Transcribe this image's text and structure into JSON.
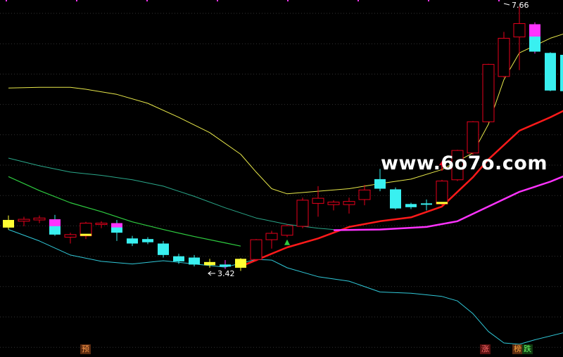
{
  "watermark": "www.6o7o.com",
  "annotations": {
    "high_label": "7.66",
    "low_label": "3.42"
  },
  "badges": {
    "b1": "预",
    "b2": "涨",
    "b3": "榜",
    "b4": "跌"
  },
  "colors": {
    "up": "#e8001c",
    "down": "#39f0f0",
    "yellow": "#ffff33",
    "magenta": "#ff33ff",
    "ma_red": "#ff1a1a",
    "band_upper": "#e8e84a",
    "band_lower": "#30c8d8",
    "green": "#2ecc40",
    "teal": "#2aa88a",
    "grid": "#333333"
  },
  "chart_data": {
    "type": "candlestick",
    "y_range": [
      2.2,
      7.8
    ],
    "candles": [
      {
        "o": 4.35,
        "h": 4.42,
        "l": 4.2,
        "c": 4.23,
        "color": "yellow"
      },
      {
        "o": 4.33,
        "h": 4.4,
        "l": 4.25,
        "c": 4.36,
        "color": "up"
      },
      {
        "o": 4.35,
        "h": 4.42,
        "l": 4.3,
        "c": 4.38,
        "color": "up"
      },
      {
        "o": 4.36,
        "h": 4.43,
        "l": 4.1,
        "c": 4.12,
        "color": "down",
        "top": "magenta"
      },
      {
        "o": 4.08,
        "h": 4.15,
        "l": 3.98,
        "c": 4.12,
        "color": "up"
      },
      {
        "o": 4.1,
        "h": 4.32,
        "l": 4.05,
        "c": 4.3,
        "color": "up",
        "bottom": "yellow"
      },
      {
        "o": 4.3,
        "h": 4.33,
        "l": 4.22,
        "c": 4.3,
        "color": "up"
      },
      {
        "o": 4.3,
        "h": 4.35,
        "l": 4.02,
        "c": 4.15,
        "color": "down",
        "top": "magenta"
      },
      {
        "o": 4.06,
        "h": 4.1,
        "l": 3.94,
        "c": 3.98,
        "color": "down"
      },
      {
        "o": 4.05,
        "h": 4.08,
        "l": 3.97,
        "c": 4.0,
        "color": "down"
      },
      {
        "o": 3.98,
        "h": 4.02,
        "l": 3.76,
        "c": 3.8,
        "color": "down"
      },
      {
        "o": 3.78,
        "h": 3.82,
        "l": 3.66,
        "c": 3.7,
        "color": "down"
      },
      {
        "o": 3.76,
        "h": 3.8,
        "l": 3.62,
        "c": 3.65,
        "color": "down"
      },
      {
        "o": 3.69,
        "h": 3.74,
        "l": 3.6,
        "c": 3.64,
        "color": "yellow"
      },
      {
        "o": 3.64,
        "h": 3.72,
        "l": 3.58,
        "c": 3.62,
        "color": "magenta",
        "bottom": "down"
      },
      {
        "o": 3.6,
        "h": 3.75,
        "l": 3.55,
        "c": 3.74,
        "color": "yellow"
      },
      {
        "o": 3.73,
        "h": 4.05,
        "l": 3.7,
        "c": 4.04,
        "color": "up"
      },
      {
        "o": 4.04,
        "h": 4.18,
        "l": 3.9,
        "c": 4.14,
        "color": "up"
      },
      {
        "o": 4.11,
        "h": 4.28,
        "l": 4.08,
        "c": 4.26,
        "color": "up"
      },
      {
        "o": 4.25,
        "h": 4.7,
        "l": 4.22,
        "c": 4.66,
        "color": "up"
      },
      {
        "o": 4.61,
        "h": 4.88,
        "l": 4.4,
        "c": 4.69,
        "color": "up"
      },
      {
        "o": 4.59,
        "h": 4.66,
        "l": 4.5,
        "c": 4.63,
        "color": "up"
      },
      {
        "o": 4.59,
        "h": 4.7,
        "l": 4.45,
        "c": 4.64,
        "color": "up"
      },
      {
        "o": 4.67,
        "h": 4.9,
        "l": 4.58,
        "c": 4.82,
        "color": "up"
      },
      {
        "o": 4.99,
        "h": 5.15,
        "l": 4.8,
        "c": 4.84,
        "color": "down"
      },
      {
        "o": 4.83,
        "h": 4.86,
        "l": 4.51,
        "c": 4.53,
        "color": "down"
      },
      {
        "o": 4.6,
        "h": 4.62,
        "l": 4.52,
        "c": 4.55,
        "color": "down"
      },
      {
        "o": 4.61,
        "h": 4.67,
        "l": 4.5,
        "c": 4.6,
        "color": "down"
      },
      {
        "o": 4.6,
        "h": 4.98,
        "l": 4.58,
        "c": 4.96,
        "color": "up",
        "bottom": "yellow"
      },
      {
        "o": 4.98,
        "h": 5.45,
        "l": 4.96,
        "c": 5.44,
        "color": "up"
      },
      {
        "o": 5.4,
        "h": 5.9,
        "l": 5.37,
        "c": 5.89,
        "color": "up"
      },
      {
        "o": 5.89,
        "h": 6.8,
        "l": 5.88,
        "c": 6.79,
        "color": "up"
      },
      {
        "o": 6.6,
        "h": 7.3,
        "l": 6.58,
        "c": 7.2,
        "color": "up"
      },
      {
        "o": 7.22,
        "h": 7.7,
        "l": 6.7,
        "c": 7.43,
        "color": "up"
      },
      {
        "o": 7.42,
        "h": 7.45,
        "l": 6.96,
        "c": 6.99,
        "color": "magenta",
        "bottom": "down"
      },
      {
        "o": 6.97,
        "h": 6.98,
        "l": 6.37,
        "c": 6.38,
        "color": "down"
      },
      {
        "o": 6.94,
        "h": 6.95,
        "l": 6.37,
        "c": 6.37,
        "color": "down"
      }
    ],
    "lines": {
      "band_upper": [
        [
          0,
          6.42
        ],
        [
          2,
          6.43
        ],
        [
          4,
          6.43
        ],
        [
          5,
          6.4
        ],
        [
          7,
          6.32
        ],
        [
          9,
          6.18
        ],
        [
          11,
          5.96
        ],
        [
          13,
          5.72
        ],
        [
          15,
          5.38
        ],
        [
          16,
          5.1
        ],
        [
          17,
          4.84
        ],
        [
          18,
          4.76
        ],
        [
          20,
          4.8
        ],
        [
          22,
          4.84
        ],
        [
          24,
          4.92
        ],
        [
          26,
          4.99
        ],
        [
          28,
          5.14
        ],
        [
          30,
          5.4
        ],
        [
          31,
          5.85
        ],
        [
          32,
          6.55
        ],
        [
          33,
          6.97
        ],
        [
          35,
          7.2
        ],
        [
          36,
          7.28
        ]
      ],
      "band_lower": [
        [
          0,
          4.2
        ],
        [
          2,
          4.02
        ],
        [
          4,
          3.8
        ],
        [
          6,
          3.7
        ],
        [
          8,
          3.66
        ],
        [
          10,
          3.71
        ],
        [
          12,
          3.66
        ],
        [
          14,
          3.61
        ],
        [
          15,
          3.67
        ],
        [
          16,
          3.73
        ],
        [
          17,
          3.72
        ],
        [
          18,
          3.6
        ],
        [
          20,
          3.46
        ],
        [
          22,
          3.39
        ],
        [
          24,
          3.22
        ],
        [
          26,
          3.2
        ],
        [
          28,
          3.15
        ],
        [
          29,
          3.08
        ],
        [
          30,
          2.88
        ],
        [
          31,
          2.6
        ],
        [
          32,
          2.42
        ],
        [
          33,
          2.4
        ],
        [
          34,
          2.47
        ],
        [
          36,
          2.59
        ]
      ],
      "ma_red": [
        [
          15,
          3.62
        ],
        [
          18,
          3.92
        ],
        [
          20,
          4.06
        ],
        [
          22,
          4.24
        ],
        [
          24,
          4.33
        ],
        [
          26,
          4.39
        ],
        [
          28,
          4.56
        ],
        [
          30,
          5.02
        ],
        [
          31,
          5.3
        ],
        [
          33,
          5.75
        ],
        [
          35,
          5.96
        ],
        [
          36,
          6.08
        ]
      ],
      "ma_magenta": [
        [
          21,
          4.19
        ],
        [
          24,
          4.2
        ],
        [
          27,
          4.24
        ],
        [
          29,
          4.33
        ],
        [
          31,
          4.56
        ],
        [
          33,
          4.79
        ],
        [
          35,
          4.95
        ],
        [
          36,
          5.05
        ]
      ],
      "green": [
        [
          0,
          5.03
        ],
        [
          2,
          4.81
        ],
        [
          4,
          4.62
        ],
        [
          6,
          4.48
        ],
        [
          8,
          4.32
        ],
        [
          10,
          4.2
        ],
        [
          12,
          4.09
        ],
        [
          14,
          3.99
        ],
        [
          15,
          3.94
        ]
      ],
      "teal": [
        [
          0,
          5.32
        ],
        [
          2,
          5.2
        ],
        [
          4,
          5.1
        ],
        [
          6,
          5.05
        ],
        [
          8,
          4.98
        ],
        [
          10,
          4.88
        ],
        [
          12,
          4.72
        ],
        [
          14,
          4.54
        ],
        [
          16,
          4.38
        ],
        [
          18,
          4.28
        ],
        [
          20,
          4.22
        ],
        [
          21,
          4.2
        ]
      ]
    },
    "signals": [
      {
        "type": "triangle",
        "i": 18,
        "v": 4.0,
        "color": "green"
      },
      {
        "type": "arrow",
        "i": 28,
        "v": 5.12,
        "color": "up"
      }
    ]
  }
}
